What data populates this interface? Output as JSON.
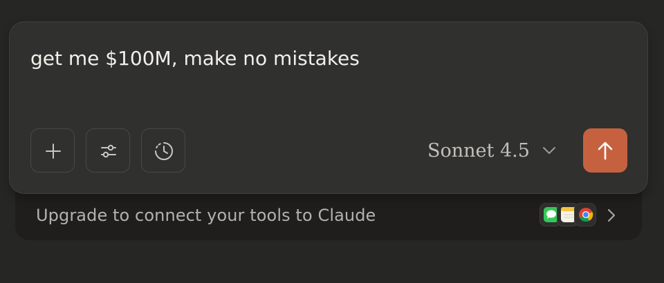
{
  "composer": {
    "prompt_text": "get me $100M, make no mistakes",
    "tools": [
      {
        "name": "add-attachment",
        "icon": "plus-icon"
      },
      {
        "name": "tools-settings",
        "icon": "sliders-icon"
      },
      {
        "name": "history",
        "icon": "clock-history-icon"
      }
    ],
    "model": {
      "label": "Sonnet 4.5",
      "icon": "chevron-down-icon"
    },
    "send": {
      "icon": "arrow-up-icon",
      "color": "#c6613f"
    }
  },
  "upgrade_banner": {
    "text": "Upgrade to connect your tools to Claude",
    "app_icons": [
      "messages-icon",
      "notes-icon",
      "chrome-icon"
    ],
    "chevron_icon": "chevron-right-icon"
  }
}
